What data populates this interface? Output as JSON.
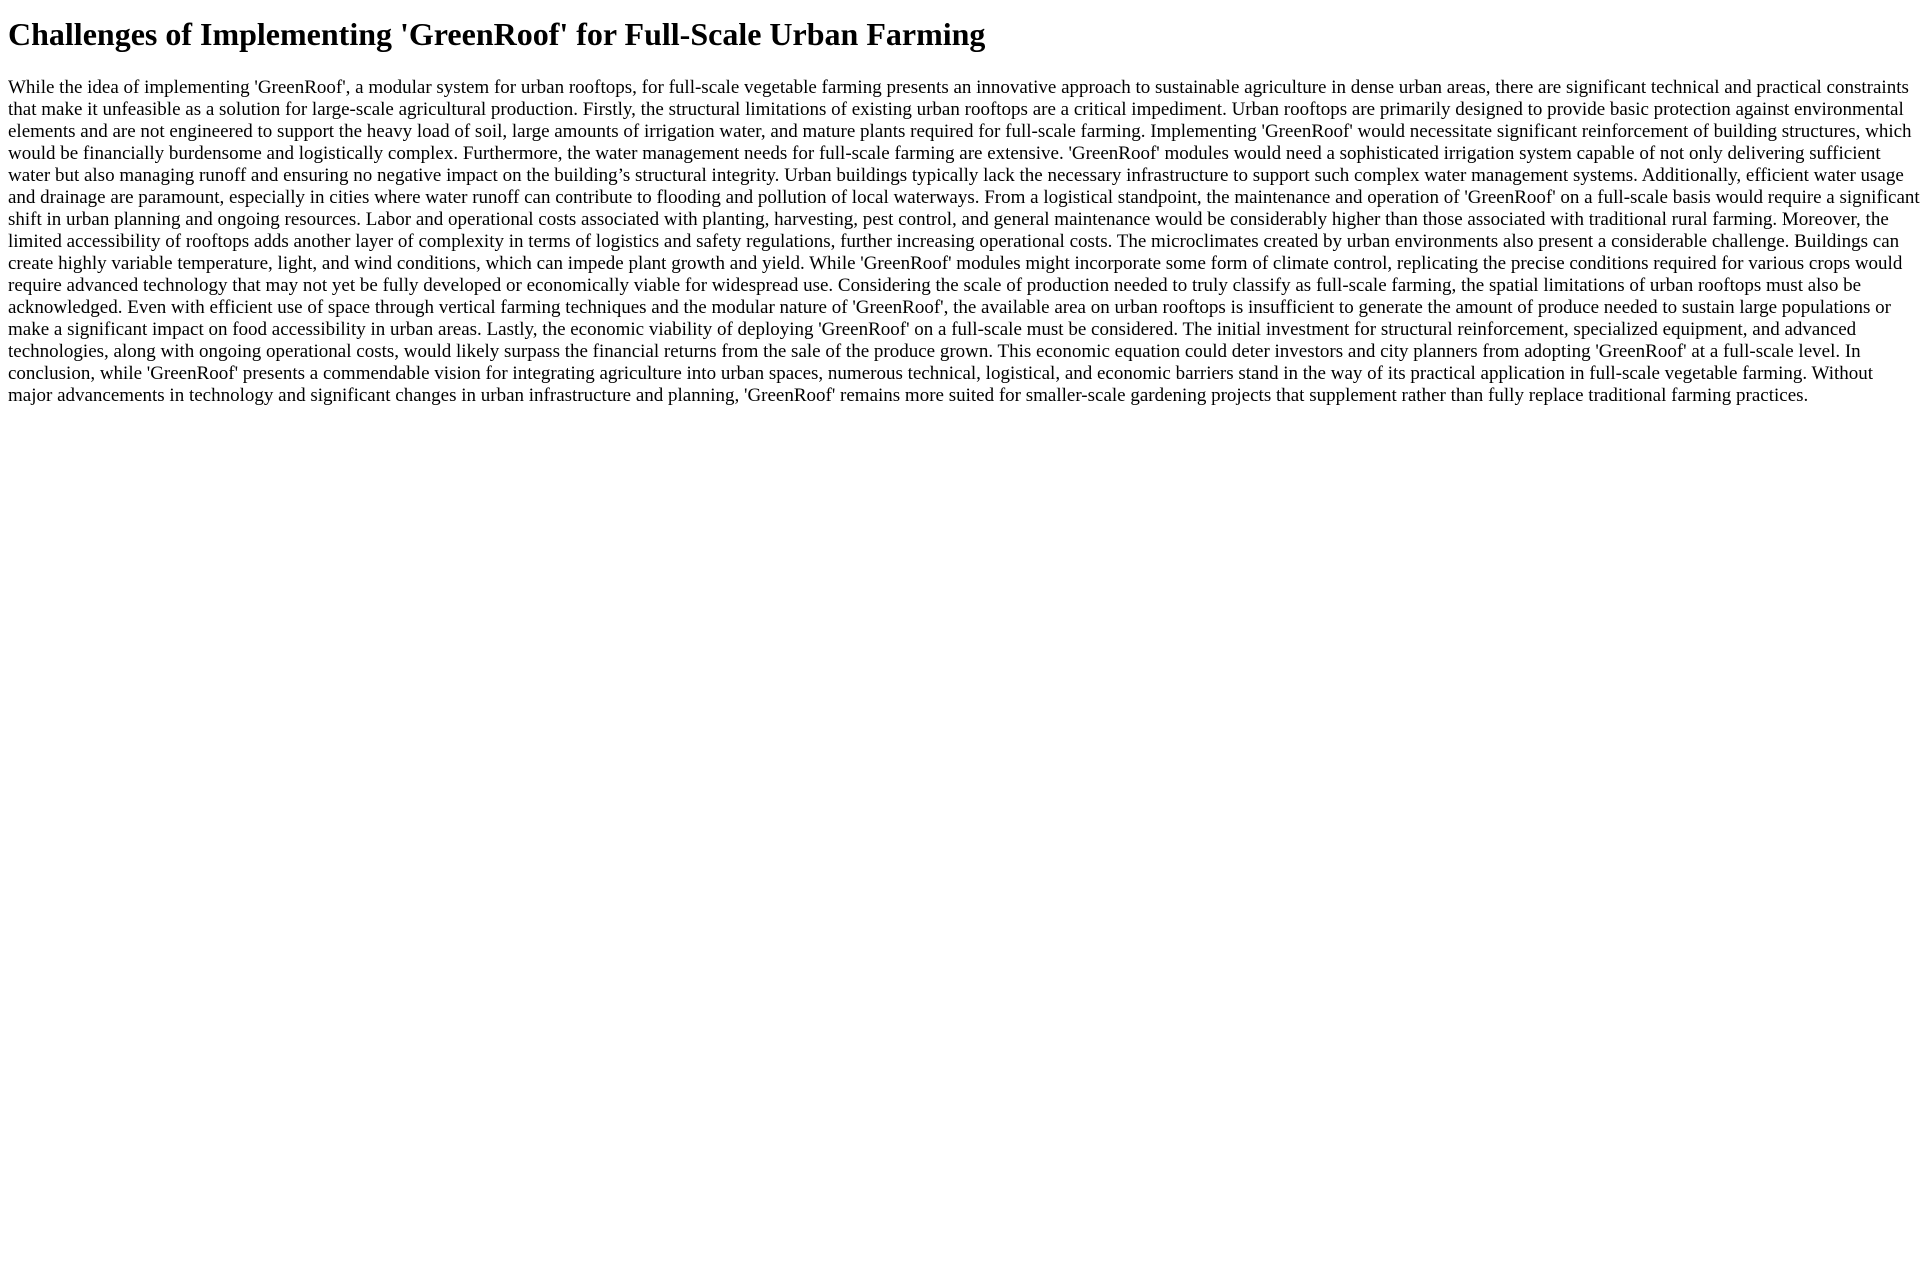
{
  "document": {
    "title": "Challenges of Implementing 'GreenRoof' for Full-Scale Urban Farming",
    "body": "While the idea of implementing 'GreenRoof', a modular system for urban rooftops, for full-scale vegetable farming presents an innovative approach to sustainable agriculture in dense urban areas, there are significant technical and practical constraints that make it unfeasible as a solution for large-scale agricultural production. Firstly, the structural limitations of existing urban rooftops are a critical impediment. Urban rooftops are primarily designed to provide basic protection against environmental elements and are not engineered to support the heavy load of soil, large amounts of irrigation water, and mature plants required for full-scale farming. Implementing 'GreenRoof' would necessitate significant reinforcement of building structures, which would be financially burdensome and logistically complex. Furthermore, the water management needs for full-scale farming are extensive. 'GreenRoof' modules would need a sophisticated irrigation system capable of not only delivering sufficient water but also managing runoff and ensuring no negative impact on the building’s structural integrity. Urban buildings typically lack the necessary infrastructure to support such complex water management systems. Additionally, efficient water usage and drainage are paramount, especially in cities where water runoff can contribute to flooding and pollution of local waterways. From a logistical standpoint, the maintenance and operation of 'GreenRoof' on a full-scale basis would require a significant shift in urban planning and ongoing resources. Labor and operational costs associated with planting, harvesting, pest control, and general maintenance would be considerably higher than those associated with traditional rural farming. Moreover, the limited accessibility of rooftops adds another layer of complexity in terms of logistics and safety regulations, further increasing operational costs. The microclimates created by urban environments also present a considerable challenge. Buildings can create highly variable temperature, light, and wind conditions, which can impede plant growth and yield. While 'GreenRoof' modules might incorporate some form of climate control, replicating the precise conditions required for various crops would require advanced technology that may not yet be fully developed or economically viable for widespread use. Considering the scale of production needed to truly classify as full-scale farming, the spatial limitations of urban rooftops must also be acknowledged. Even with efficient use of space through vertical farming techniques and the modular nature of 'GreenRoof', the available area on urban rooftops is insufficient to generate the amount of produce needed to sustain large populations or make a significant impact on food accessibility in urban areas. Lastly, the economic viability of deploying 'GreenRoof' on a full-scale must be considered. The initial investment for structural reinforcement, specialized equipment, and advanced technologies, along with ongoing operational costs, would likely surpass the financial returns from the sale of the produce grown. This economic equation could deter investors and city planners from adopting 'GreenRoof' at a full-scale level. In conclusion, while 'GreenRoof' presents a commendable vision for integrating agriculture into urban spaces, numerous technical, logistical, and economic barriers stand in the way of its practical application in full-scale vegetable farming. Without major advancements in technology and significant changes in urban infrastructure and planning, 'GreenRoof' remains more suited for smaller-scale gardening projects that supplement rather than fully replace traditional farming practices."
  }
}
